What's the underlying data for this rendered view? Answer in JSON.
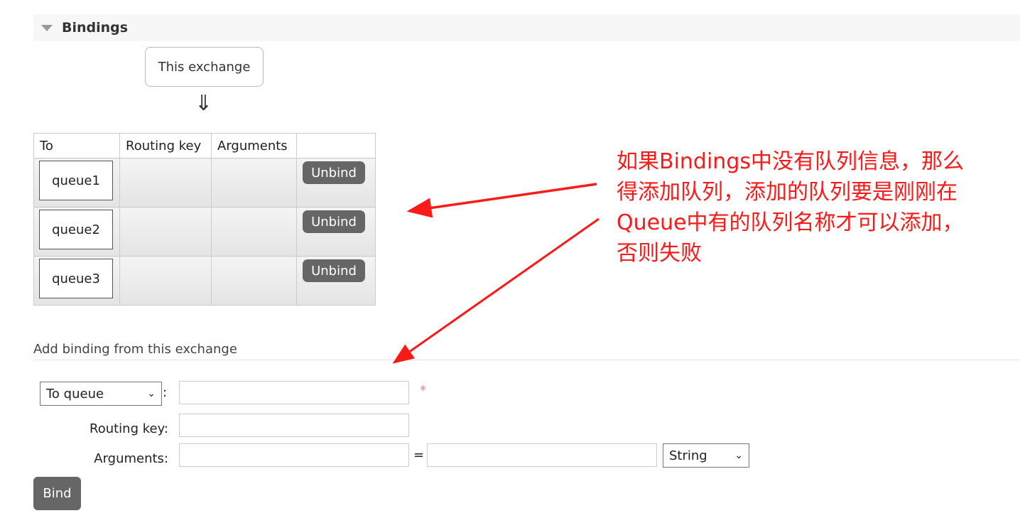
{
  "section": {
    "title": "Bindings",
    "toggle_icon": "triangle-down-icon"
  },
  "diagram": {
    "source_label": "This exchange",
    "arrow": "⇓"
  },
  "bindings_table": {
    "columns": [
      "To",
      "Routing key",
      "Arguments",
      ""
    ],
    "rows": [
      {
        "to": "queue1",
        "routing_key": "",
        "arguments": "",
        "action": "Unbind"
      },
      {
        "to": "queue2",
        "routing_key": "",
        "arguments": "",
        "action": "Unbind"
      },
      {
        "to": "queue3",
        "routing_key": "",
        "arguments": "",
        "action": "Unbind"
      }
    ]
  },
  "add_binding": {
    "title": "Add binding from this exchange",
    "destination_type": "To queue",
    "colon": ":",
    "required_mark": "*",
    "routing_key_label": "Routing key:",
    "arguments_label": "Arguments:",
    "equals": "=",
    "argument_type": "String",
    "bind_label": "Bind"
  },
  "annotation": {
    "lines": [
      "如果Bindings中没有队列信息，那么",
      "得添加队列，添加的队列要是刚刚在",
      "Queue中有的队列名称才可以添加，",
      "否则失败"
    ],
    "color": "#ff1a1a"
  }
}
